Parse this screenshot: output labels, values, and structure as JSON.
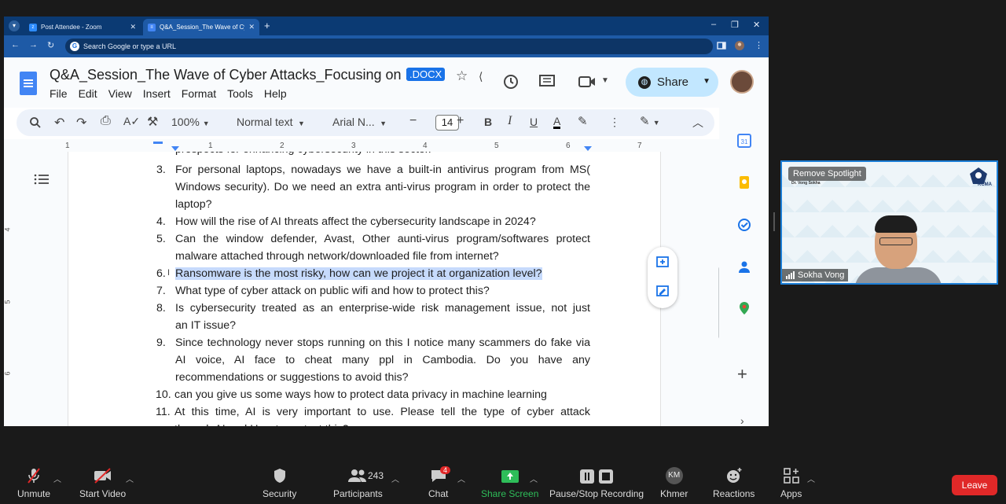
{
  "browser": {
    "tabs": [
      {
        "title": "Post Attendee - Zoom",
        "active": false
      },
      {
        "title": "Q&A_Session_The Wave of Cyb",
        "active": true
      }
    ],
    "omnibox_placeholder": "Search Google or type a URL"
  },
  "docs": {
    "title": "Q&A_Session_The Wave of Cyber Attacks_Focusing on F...",
    "format_badge": ".DOCX",
    "menu": [
      "File",
      "Edit",
      "View",
      "Insert",
      "Format",
      "Tools",
      "Help"
    ],
    "share_label": "Share",
    "toolbar": {
      "zoom": "100%",
      "style": "Normal text",
      "font": "Arial N...",
      "font_size": "14",
      "bold": "B",
      "italic": "I",
      "underline": "U",
      "text_color": "A"
    },
    "ruler_numbers": [
      "1",
      "1",
      "2",
      "3",
      "4",
      "5",
      "6",
      "7"
    ],
    "vruler_numbers": [
      "4",
      "5",
      "6"
    ],
    "partial_top_line": "prospects for enhancing cybersecurity in this sector.",
    "questions": [
      {
        "num": "3.",
        "lines": [
          "For personal laptops, nowadays we have a built-in antivirus program from MS(",
          "Windows security). Do we need an extra anti-virus program in order to protect the",
          "laptop?"
        ]
      },
      {
        "num": "4.",
        "lines": [
          "How will the rise of AI threats affect the cybersecurity landscape in 2024?"
        ]
      },
      {
        "num": "5.",
        "lines": [
          "Can the window defender, Avast, Other aunti-virus program/softwares protect",
          "malware attached through network/downloaded file from internet?"
        ]
      },
      {
        "num": "6.",
        "lines": [
          "Ransomware is the most risky, how can we project it at organization level?"
        ],
        "highlighted": true
      },
      {
        "num": "7.",
        "lines": [
          "What type of cyber attack on public wifi and how to protect this?"
        ]
      },
      {
        "num": "8.",
        "lines": [
          " Is cybersecurity treated as an enterprise-wide risk management issue, not just",
          "an IT issue?"
        ]
      },
      {
        "num": "9.",
        "lines": [
          "Since technology never stops running on this I notice many scammers do fake via",
          "AI voice, AI face to cheat many ppl in Cambodia. Do you have any",
          "recommendations or suggestions to avoid this?"
        ]
      },
      {
        "num": "10.",
        "lines": [
          "can you give us some ways how to protect data privacy in machine learning"
        ]
      },
      {
        "num": "11.",
        "lines": [
          "At this time, AI is very important to use. Please tell the type of cyber attack",
          "through AI and How to protect this?"
        ]
      }
    ]
  },
  "zoom": {
    "video": {
      "spotlight_label": "Remove Spotlight",
      "small_name": "Dr. Vong Sokha",
      "logo_text": "KCMA",
      "participant_name": "Sokha Vong"
    },
    "controls": {
      "unmute": "Unmute",
      "start_video": "Start Video",
      "security": "Security",
      "participants": "Participants",
      "participants_count": "243",
      "chat": "Chat",
      "chat_badge": "4",
      "share_screen": "Share Screen",
      "recording": "Pause/Stop Recording",
      "khmer": "Khmer",
      "khmer_initials": "KM",
      "reactions": "Reactions",
      "apps": "Apps",
      "leave": "Leave"
    }
  },
  "colors": {
    "zoom_bg": "#1a1a1a",
    "leave_red": "#e02828",
    "share_green": "#2ebd59",
    "docs_blue": "#1a73e8",
    "highlight": "#c6dafc"
  }
}
